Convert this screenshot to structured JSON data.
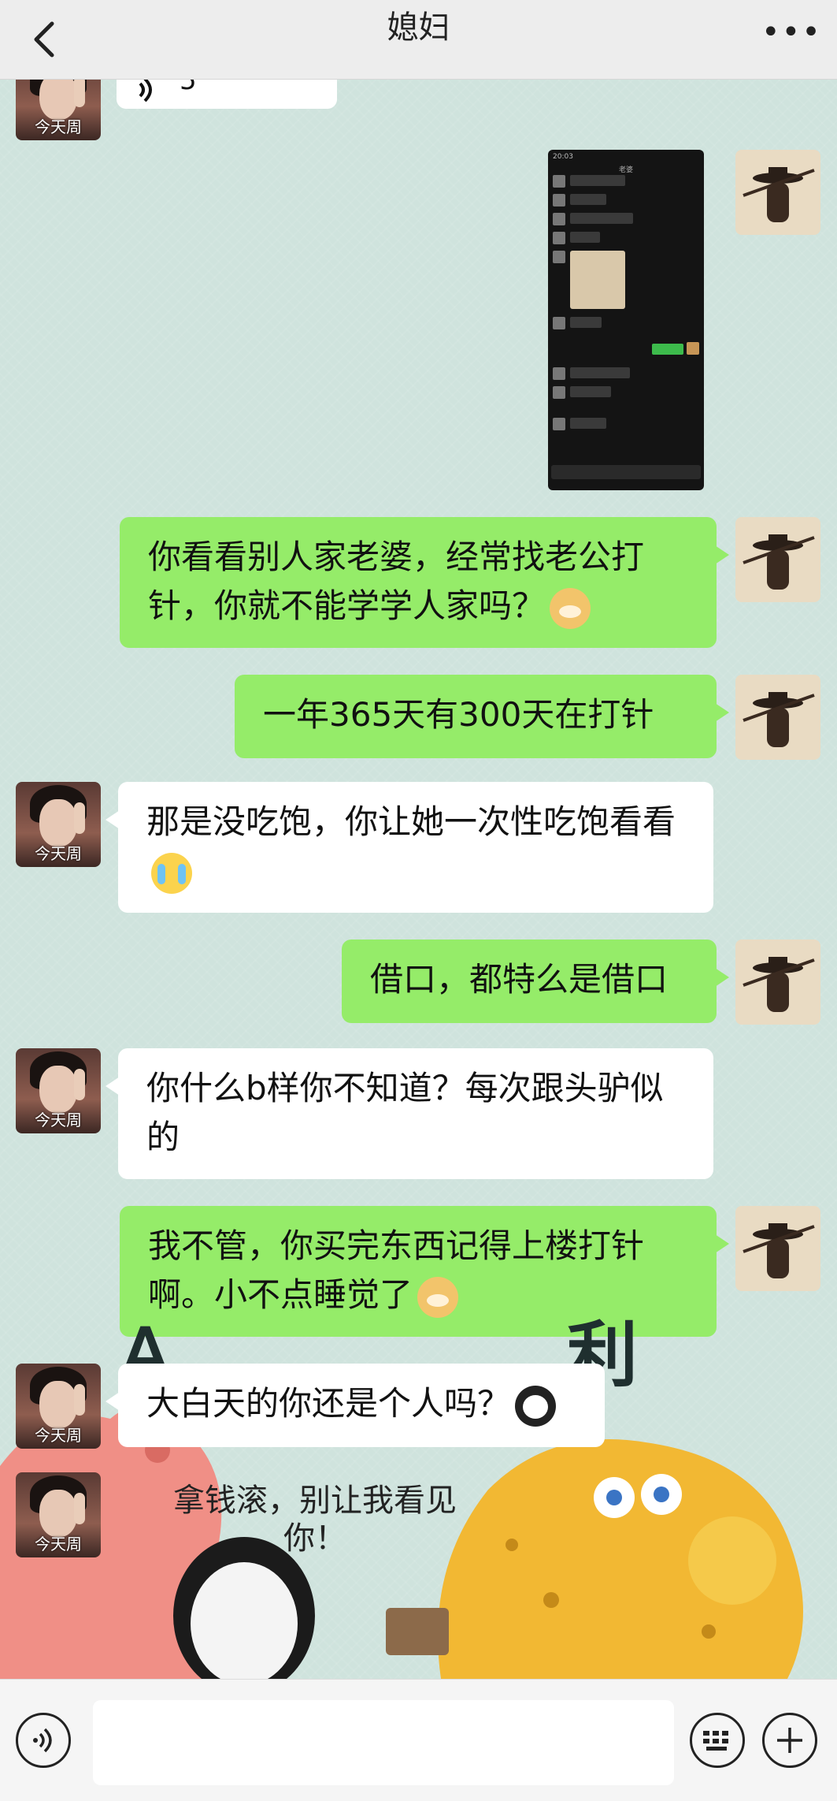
{
  "header": {
    "title": "媳妇",
    "more": "•••"
  },
  "voice_message": {
    "duration": "5\""
  },
  "screenshot_message": {
    "time": "20:03",
    "contact": "老婆",
    "lines": [
      "能是你放的屁吗",
      "上楼干不",
      "谁让你下午叫引我",
      "忽不去",
      "借住耳朵 就不会骂怎样",
      "不回我?",
      "不给我",
      "下次我让你硬岔吧",
      "今天又没干",
      "能天干的吧"
    ],
    "sent": "就这样"
  },
  "messages": [
    {
      "side": "right",
      "text": "你看看别人家老婆，经常找老公打针，你就不能学学人家吗？",
      "emoji": "doge"
    },
    {
      "side": "right",
      "text": "一年365天有300天在打针"
    },
    {
      "side": "left",
      "text": "那是没吃饱，你让她一次性吃饱看看",
      "emoji": "cry"
    },
    {
      "side": "right",
      "text": "借口，都特么是借口"
    },
    {
      "side": "left",
      "text": "你什么b样你不知道？每次跟头驴似的"
    },
    {
      "side": "right",
      "text": "我不管，你买完东西记得上楼打针啊。小不点睡觉了",
      "emoji": "doge"
    },
    {
      "side": "left",
      "text": "大白天的你还是个人吗？",
      "emoji": "panda"
    }
  ],
  "left_avatar_caption": "今天周",
  "sticker": {
    "text": "拿钱滚，别让我看见你！"
  },
  "bottom": {
    "voice_icon": "voice-icon",
    "keyboard_icon": "keyboard-icon",
    "plus_icon": "plus-icon"
  }
}
